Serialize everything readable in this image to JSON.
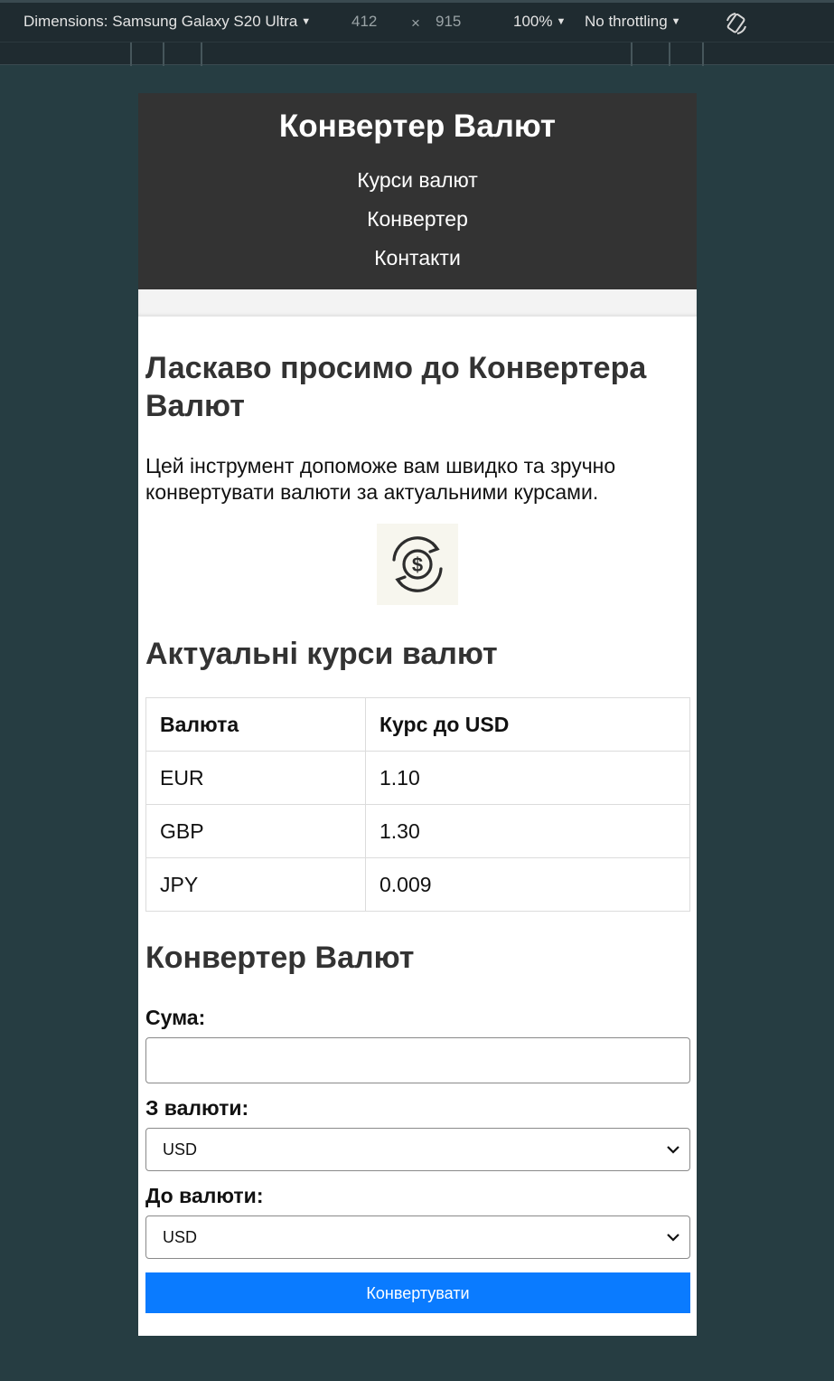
{
  "devtools": {
    "device_label": "Dimensions: Samsung Galaxy S20 Ultra",
    "width": "412",
    "times": "×",
    "height": "915",
    "zoom": "100%",
    "throttling": "No throttling",
    "rotate_icon": "rotate-device-icon"
  },
  "header": {
    "title": "Конвертер Валют",
    "nav": [
      "Курси валют",
      "Конвертер",
      "Контакти"
    ]
  },
  "welcome": {
    "title": "Ласкаво просимо до Конвертера Валют",
    "text": "Цей інструмент допоможе вам швидко та зручно конвертувати валюти за актуальними курсами.",
    "icon": "currency-exchange-icon"
  },
  "rates": {
    "title": "Актуальні курси валют",
    "headers": [
      "Валюта",
      "Курс до USD"
    ],
    "rows": [
      [
        "EUR",
        "1.10"
      ],
      [
        "GBP",
        "1.30"
      ],
      [
        "JPY",
        "0.009"
      ]
    ]
  },
  "converter": {
    "title": "Конвертер Валют",
    "amount_label": "Сума:",
    "amount_value": "",
    "from_label": "З валюти:",
    "from_value": "USD",
    "to_label": "До валюти:",
    "to_value": "USD",
    "button_label": "Конвертувати",
    "button_color": "#0a7bff"
  }
}
